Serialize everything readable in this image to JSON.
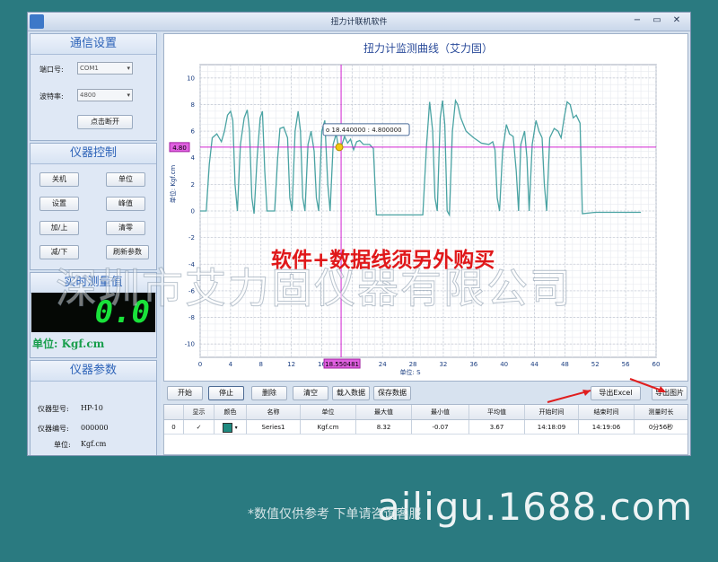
{
  "window": {
    "title": "扭力计联机软件",
    "min": "▭",
    "close": "✕"
  },
  "comm": {
    "header": "通信设置",
    "port_label": "端口号:",
    "port_value": "COM1",
    "baud_label": "波特率:",
    "baud_value": "4800",
    "connect_label": "点击断开"
  },
  "control": {
    "header": "仪器控制",
    "buttons": [
      "关机",
      "单位",
      "设置",
      "峰值",
      "加/上",
      "清零",
      "减/下",
      "刷新参数"
    ]
  },
  "measure": {
    "header": "实时测量值",
    "value": "0.0",
    "unit_text": "单位: Kgf.cm"
  },
  "params": {
    "header": "仪器参数",
    "rows": [
      {
        "label": "仪器型号:",
        "value": "HP-10"
      },
      {
        "label": "仪器编号:",
        "value": "000000"
      },
      {
        "label": "单位:",
        "value": "Kgf.cm"
      }
    ]
  },
  "chart_data": {
    "type": "line",
    "title": "扭力计监测曲线（艾力固）",
    "xlabel": "单位: S",
    "ylabel": "单位: Kgf.cm",
    "xlim": [
      0,
      60
    ],
    "ylim": [
      -11,
      11
    ],
    "xticks": [
      0,
      4,
      8,
      12,
      16,
      20,
      24,
      28,
      32,
      36,
      40,
      44,
      48,
      52,
      56,
      60
    ],
    "yticks": [
      -10,
      -8,
      -6,
      -4,
      -2,
      0,
      2,
      4,
      6,
      8,
      10
    ],
    "grid": true,
    "cursor": {
      "x": 18.550481,
      "y": 4.8,
      "x_label": "18.550481",
      "y_label": "4.80",
      "tooltip": "18.440000 : 4.800000"
    },
    "series": [
      {
        "name": "Series1",
        "color": "#4aa3a3",
        "points": [
          [
            0,
            0
          ],
          [
            0.8,
            0
          ],
          [
            1.2,
            3.5
          ],
          [
            1.6,
            5.5
          ],
          [
            2.2,
            5.8
          ],
          [
            2.8,
            5.2
          ],
          [
            3.2,
            6
          ],
          [
            3.6,
            7.2
          ],
          [
            4.0,
            7.5
          ],
          [
            4.3,
            6.8
          ],
          [
            4.6,
            2
          ],
          [
            4.9,
            0
          ],
          [
            5.3,
            5
          ],
          [
            5.8,
            7
          ],
          [
            6.2,
            7.6
          ],
          [
            6.5,
            6
          ],
          [
            6.8,
            1
          ],
          [
            7.1,
            -0.2
          ],
          [
            7.5,
            4
          ],
          [
            7.9,
            7
          ],
          [
            8.2,
            7.5
          ],
          [
            8.5,
            3
          ],
          [
            8.8,
            0
          ],
          [
            9.8,
            0
          ],
          [
            10.2,
            4
          ],
          [
            10.5,
            6.2
          ],
          [
            11,
            6.3
          ],
          [
            11.5,
            5.5
          ],
          [
            11.8,
            1
          ],
          [
            12.1,
            0
          ],
          [
            12.5,
            6
          ],
          [
            12.9,
            7.5
          ],
          [
            13.2,
            6
          ],
          [
            13.5,
            1
          ],
          [
            13.8,
            0
          ],
          [
            14.2,
            5
          ],
          [
            14.6,
            6
          ],
          [
            15.0,
            4.5
          ],
          [
            15.3,
            1
          ],
          [
            15.6,
            0
          ],
          [
            16.0,
            6
          ],
          [
            16.4,
            6.8
          ],
          [
            16.8,
            2
          ],
          [
            17.1,
            0
          ],
          [
            17.5,
            5
          ],
          [
            17.9,
            5.8
          ],
          [
            18.2,
            4.8
          ],
          [
            18.6,
            4.9
          ],
          [
            19.0,
            5.6
          ],
          [
            19.4,
            5.1
          ],
          [
            19.8,
            5.4
          ],
          [
            20.2,
            4.6
          ],
          [
            20.6,
            5.2
          ],
          [
            21.0,
            5.3
          ],
          [
            21.5,
            5.0
          ],
          [
            22.3,
            5.0
          ],
          [
            22.8,
            4.7
          ],
          [
            23.2,
            -0.3
          ],
          [
            24,
            -0.3
          ],
          [
            28,
            -0.3
          ],
          [
            29.3,
            -0.3
          ],
          [
            29.8,
            5
          ],
          [
            30.2,
            8.2
          ],
          [
            30.6,
            6
          ],
          [
            30.9,
            1
          ],
          [
            31.2,
            0
          ],
          [
            31.6,
            7
          ],
          [
            31.9,
            8.3
          ],
          [
            32.2,
            6.5
          ],
          [
            32.5,
            0
          ],
          [
            32.8,
            -0.3
          ],
          [
            33.2,
            6
          ],
          [
            33.6,
            8.3
          ],
          [
            33.9,
            8
          ],
          [
            34.3,
            7
          ],
          [
            35,
            6
          ],
          [
            36,
            5.5
          ],
          [
            37,
            5.1
          ],
          [
            38,
            5
          ],
          [
            38.5,
            5.2
          ],
          [
            38.8,
            4.6
          ],
          [
            39.1,
            1
          ],
          [
            39.4,
            0
          ],
          [
            39.8,
            4.5
          ],
          [
            40.3,
            6.5
          ],
          [
            40.7,
            5.8
          ],
          [
            41.2,
            5.6
          ],
          [
            41.6,
            3
          ],
          [
            41.9,
            0
          ],
          [
            42.2,
            5
          ],
          [
            42.7,
            6
          ],
          [
            43.0,
            4
          ],
          [
            43.3,
            0
          ],
          [
            43.7,
            5
          ],
          [
            44.2,
            6.8
          ],
          [
            44.6,
            6
          ],
          [
            45,
            5.5
          ],
          [
            45.3,
            2
          ],
          [
            45.6,
            0
          ],
          [
            46,
            5.5
          ],
          [
            46.6,
            6.2
          ],
          [
            47.1,
            6
          ],
          [
            47.5,
            5.5
          ],
          [
            47.9,
            7
          ],
          [
            48.3,
            8.2
          ],
          [
            48.7,
            8
          ],
          [
            49.1,
            7
          ],
          [
            49.5,
            7.2
          ],
          [
            50,
            6.6
          ],
          [
            50.3,
            -0.2
          ],
          [
            52,
            -0.1
          ],
          [
            56,
            -0.1
          ],
          [
            58,
            -0.1
          ]
        ]
      }
    ]
  },
  "toolbar": {
    "buttons": [
      "开始",
      "停止",
      "删除",
      "清空",
      "载入数据",
      "保存数据",
      "导出Excel",
      "导出图片"
    ]
  },
  "grid": {
    "headers": [
      "",
      "显示",
      "颜色",
      "名称",
      "单位",
      "最大值",
      "最小值",
      "平均值",
      "开始时间",
      "结束时间",
      "测量时长"
    ],
    "row": [
      "0",
      "✓",
      "",
      "Series1",
      "Kgf.cm",
      "8.32",
      "-0.07",
      "3.67",
      "14:18:09",
      "14:19:06",
      "0分56秒"
    ],
    "swatch": "#1f8a80"
  },
  "overlay": {
    "ad_text": "软件+数据线须另外购买",
    "watermark": "深圳市艾力固仪器有限公司",
    "note": "*数值仅供参考 下单请咨询客服",
    "site": "ailigu.1688.com"
  }
}
